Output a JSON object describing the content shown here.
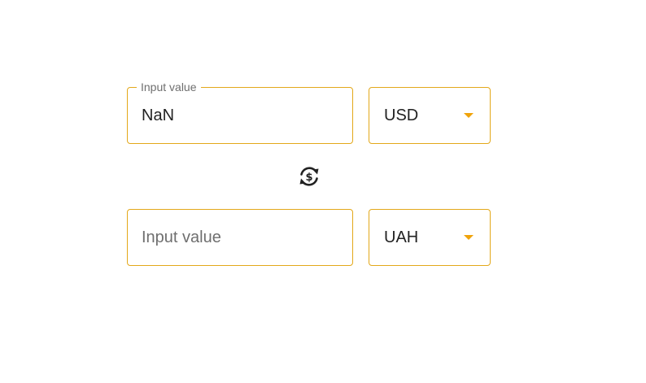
{
  "converter": {
    "from": {
      "legend": "Input value",
      "value": "NaN",
      "currency": "USD"
    },
    "to": {
      "placeholder": "Input value",
      "value": "",
      "currency": "UAH"
    },
    "swap_icon": "currency-exchange-icon"
  },
  "colors": {
    "border": "#e3a81a",
    "caret": "#f0a30a",
    "text": "#222222",
    "muted": "#6f6f6f"
  }
}
